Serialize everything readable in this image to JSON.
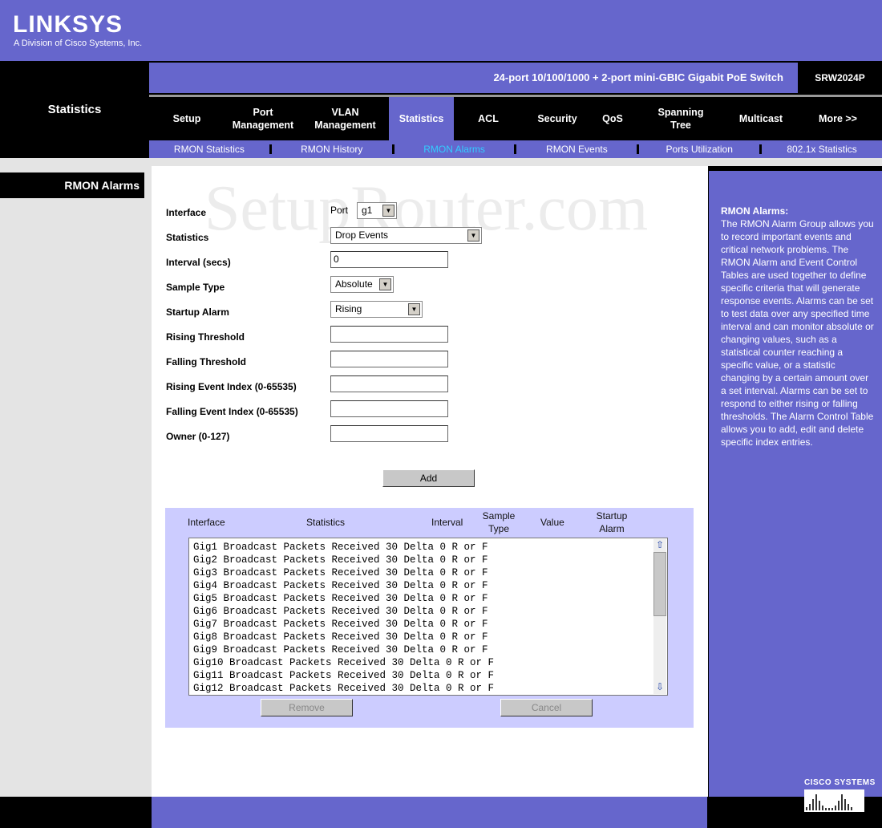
{
  "header": {
    "logo": "LINKSYS",
    "logo_sub": "A Division of Cisco Systems, Inc.",
    "product": "24-port 10/100/1000 + 2-port mini-GBIC Gigabit PoE Switch",
    "model": "SRW2024P",
    "section": "Statistics"
  },
  "tabs": [
    {
      "label": "Setup"
    },
    {
      "label": "Port Management"
    },
    {
      "label": "VLAN Management"
    },
    {
      "label": "Statistics",
      "active": true
    },
    {
      "label": "ACL"
    },
    {
      "label": "Security"
    },
    {
      "label": "QoS"
    },
    {
      "label": "Spanning Tree"
    },
    {
      "label": "Multicast"
    },
    {
      "label": "More >>"
    }
  ],
  "subtabs": [
    {
      "label": "RMON Statistics"
    },
    {
      "label": "RMON History"
    },
    {
      "label": "RMON Alarms",
      "active": true
    },
    {
      "label": "RMON Events"
    },
    {
      "label": "Ports Utilization"
    },
    {
      "label": "802.1x Statistics"
    }
  ],
  "sidebar": {
    "item": "RMON Alarms"
  },
  "watermark": "SetupRouter.com",
  "form": {
    "interface_label": "Interface",
    "port_label": "Port",
    "port_value": "g1",
    "statistics_label": "Statistics",
    "statistics_value": "Drop Events",
    "interval_label": "Interval (secs)",
    "interval_value": "0",
    "sample_type_label": "Sample Type",
    "sample_type_value": "Absolute",
    "startup_alarm_label": "Startup Alarm",
    "startup_alarm_value": "Rising",
    "rising_threshold_label": "Rising Threshold",
    "rising_threshold_value": "",
    "falling_threshold_label": "Falling Threshold",
    "falling_threshold_value": "",
    "rising_event_label": "Rising Event Index (0-65535)",
    "rising_event_value": "",
    "falling_event_label": "Falling Event Index (0-65535)",
    "falling_event_value": "",
    "owner_label": "Owner (0-127)",
    "owner_value": "",
    "add": "Add"
  },
  "table": {
    "headers": [
      "Interface",
      "Statistics",
      "Interval",
      "Sample Type",
      "Value",
      "Startup Alarm"
    ],
    "rows": [
      "Gig1 Broadcast Packets Received 30 Delta 0 R or F",
      "Gig2 Broadcast Packets Received 30 Delta 0 R or F",
      "Gig3 Broadcast Packets Received 30 Delta 0 R or F",
      "Gig4 Broadcast Packets Received 30 Delta 0 R or F",
      "Gig5 Broadcast Packets Received 30 Delta 0 R or F",
      "Gig6 Broadcast Packets Received 30 Delta 0 R or F",
      "Gig7 Broadcast Packets Received 30 Delta 0 R or F",
      "Gig8 Broadcast Packets Received 30 Delta 0 R or F",
      "Gig9 Broadcast Packets Received 30 Delta 0 R or F",
      "Gig10 Broadcast Packets Received 30 Delta 0 R or F",
      "Gig11 Broadcast Packets Received 30 Delta 0 R or F",
      "Gig12 Broadcast Packets Received 30 Delta 0 R or F"
    ],
    "remove": "Remove",
    "cancel": "Cancel"
  },
  "help": {
    "title": "RMON Alarms:",
    "text": "The RMON Alarm Group allows you to record important events and critical network problems. The RMON Alarm and Event Control Tables are used together to define specific criteria that will generate response events. Alarms can be set to test data over any specified time interval and can monitor absolute or changing values, such as a statistical counter reaching a specific value, or a statistic changing by a certain amount over a set interval. Alarms can be set to respond to either rising or falling thresholds. The Alarm Control Table allows you to add, edit and delete specific index entries."
  },
  "footer": {
    "cisco": "CISCO SYSTEMS"
  },
  "colors": {
    "brand": "#6666cc",
    "active_subtab": "#33ccff",
    "table_bg": "#ccccff"
  }
}
